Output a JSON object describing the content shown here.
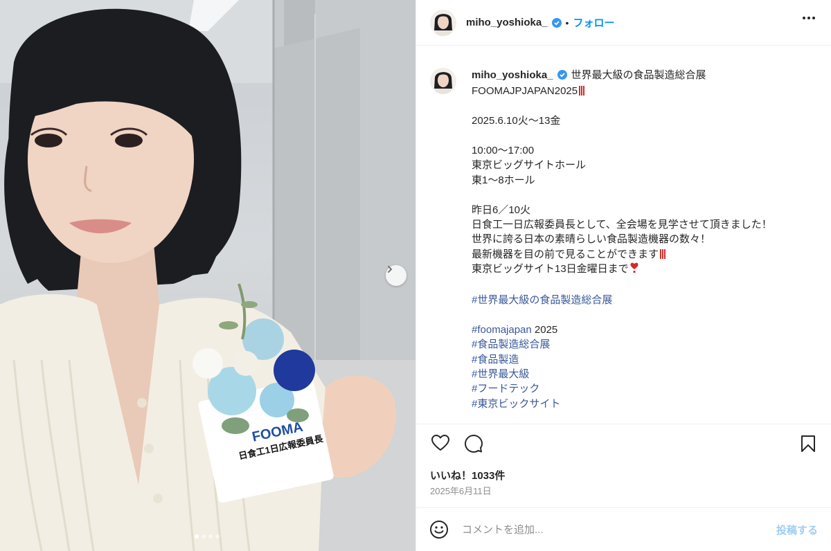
{
  "post": {
    "author": "miho_yoshioka_",
    "follow_label": "フォロー",
    "separator": "•",
    "badge_text": {
      "logo": "FOOMA",
      "title": "日食工1日広報委員長"
    },
    "caption_lines": [
      {
        "text": "世界最大級の食品製造総合展",
        "type": "text"
      },
      {
        "text": "FOOMAJPJAPAN2025",
        "type": "text",
        "emoji": "bars"
      },
      {
        "text": "",
        "type": "blank"
      },
      {
        "text": "2025.6.10火〜13金",
        "type": "text"
      },
      {
        "text": "",
        "type": "blank"
      },
      {
        "text": "10:00〜17:00",
        "type": "text"
      },
      {
        "text": "東京ビッグサイトホール",
        "type": "text"
      },
      {
        "text": "東1〜8ホール",
        "type": "text"
      },
      {
        "text": "",
        "type": "blank"
      },
      {
        "text": "昨日6／10火",
        "type": "text"
      },
      {
        "text": "日食工一日広報委員長として、全会場を見学させて頂きました！",
        "type": "text"
      },
      {
        "text": "世界に誇る日本の素晴らしい食品製造機器の数々！",
        "type": "text"
      },
      {
        "text": "最新機器を目の前で見ることができます",
        "type": "text",
        "emoji": "bars"
      },
      {
        "text": "東京ビッグサイト13日金曜日まで",
        "type": "text",
        "emoji": "heart"
      },
      {
        "text": "",
        "type": "blank"
      },
      {
        "text": "#世界最大級の食品製造総合展",
        "type": "tag"
      },
      {
        "text": "",
        "type": "blank"
      },
      {
        "text": "#foomajapan",
        "type": "tag",
        "suffix": " 2025"
      },
      {
        "text": "#食品製造総合展",
        "type": "tag"
      },
      {
        "text": "#食品製造",
        "type": "tag"
      },
      {
        "text": "#世界最大級",
        "type": "tag"
      },
      {
        "text": "#フードテック",
        "type": "tag"
      },
      {
        "text": "#東京ビックサイト",
        "type": "tag"
      }
    ],
    "likes": "いいね！1033件",
    "date": "2025年6月11日",
    "carousel": {
      "total": 4,
      "active": 1
    }
  },
  "comment": {
    "placeholder": "コメントを追加...",
    "post_label": "投稿する"
  },
  "colors": {
    "accent": "#0095f6",
    "hashtag": "#385898",
    "verified": "#3897f0",
    "muted": "#8e8e8e"
  },
  "icons": [
    "verified-icon",
    "more-options-icon",
    "heart-icon",
    "comment-icon",
    "bookmark-icon",
    "emoji-icon",
    "chevron-right-icon"
  ]
}
